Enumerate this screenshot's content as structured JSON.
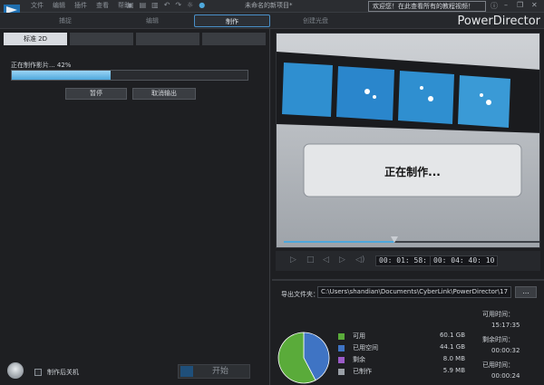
{
  "menu": [
    "文件",
    "编辑",
    "插件",
    "查看",
    "帮助"
  ],
  "project_title": "未命名的新项目*",
  "welcome_text": "欢迎您！在此查看所有的教程视频！",
  "brand": "PowerDirector",
  "modes": [
    "捕捉",
    "编辑",
    "制作",
    "创建光盘"
  ],
  "active_mode": "制作",
  "subtabs": [
    "标准 2D",
    "",
    "",
    ""
  ],
  "progress": {
    "label": "正在制作影片... 42%",
    "value": 0.42
  },
  "buttons": {
    "pause": "暂停",
    "cancel": "取消输出",
    "start": "开始"
  },
  "shutdown_label": "制作后关机",
  "preview": {
    "status": "正在制作..."
  },
  "timecodes": {
    "current": "00: 01: 58: 18",
    "total": "00: 04: 40: 10"
  },
  "export": {
    "label": "导出文件夹：",
    "path": "C:\\Users\\shandian\\Documents\\CyberLink\\PowerDirector\\17",
    "browse": "..."
  },
  "disk": [
    {
      "name": "可用",
      "value": "60.1 GB",
      "color": "#5aab3a"
    },
    {
      "name": "已用空间",
      "value": "44.1 GB",
      "color": "#3f74c4"
    },
    {
      "name": "剩余",
      "value": "8.0 MB",
      "color": "#9b5bc8"
    },
    {
      "name": "已制作",
      "value": "5.9 MB",
      "color": "#9aa0a7"
    }
  ],
  "pie_fractions": {
    "available": 0.577,
    "used": 0.423
  },
  "times": {
    "elapsed_label": "可用时间：",
    "elapsed": "15:17:35",
    "remaining_label": "剩余时间：",
    "remaining": "00:00:32",
    "used_label": "已用时间：",
    "used": "00:00:24"
  }
}
